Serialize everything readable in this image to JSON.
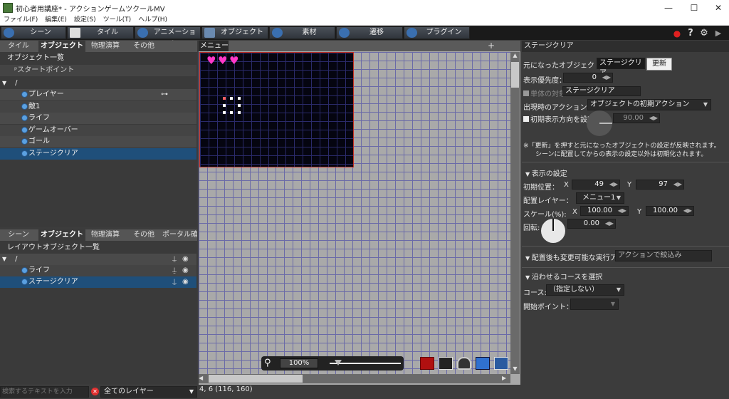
{
  "window": {
    "title": "初心者用講座* - アクションゲームツクールMV",
    "min": "—",
    "max": "☐",
    "close": "✕"
  },
  "menu": [
    "ファイル(F)",
    "編集(E)",
    "設定(S)",
    "ツール(T)",
    "ヘルプ(H)"
  ],
  "toolbar": {
    "tabs": [
      "シーン",
      "タイル",
      "アニメーション",
      "オブジェクト",
      "素材",
      "遷移",
      "プラグイン"
    ],
    "icons": {
      "stop": "●",
      "help": "?",
      "settings": "⚙",
      "play": "▶"
    },
    "colors": {
      "stop": "#e02020"
    }
  },
  "left_top": {
    "tabs": [
      "タイル",
      "オブジェクト",
      "物理演算",
      "その他"
    ],
    "header": "オブジェクト一覧",
    "start_point": "スタートポイント",
    "folder": "/",
    "items": [
      "プレイヤー",
      "敵1",
      "ライフ",
      "ゲームオーバー",
      "ゴール",
      "ステージクリア"
    ],
    "selected_index": 5,
    "gamepad_icon": "gamepad-icon"
  },
  "left_bottom": {
    "tabs": [
      "シーン",
      "オブジェクト",
      "物理演算",
      "その他",
      "ポータル確"
    ],
    "header": "レイアウトオブジェクト一覧",
    "folder": "/",
    "items": [
      "ライフ",
      "ステージクリア"
    ],
    "selected_index": 1
  },
  "canvas": {
    "tab": "メニュー1",
    "zoom": "100%",
    "zoom_slider": 0.12,
    "scrollbar_v": "▲",
    "scrollbar_down": "▼",
    "scroll_left": "◀",
    "scroll_right": "▶",
    "plus": "+"
  },
  "status": {
    "coords": "4, 6 (116, 160)",
    "search_placeholder": "検索するテキストを入力",
    "layer": "全てのレイヤー"
  },
  "right": {
    "title": "ステージクリア",
    "source_label": "元になったオブジェクト:",
    "source_value": "ステージクリア",
    "update": "更新",
    "priority_label": "表示優先度：",
    "priority_value": "0",
    "single_label": "単体の対象",
    "single_value": "ステージクリア",
    "appear_action_label": "出現時のアクション:",
    "appear_action_value": "オブジェクトの初期アクション",
    "initial_dir_label": "初期表示方向を設定",
    "initial_dir_value": "90.00",
    "note1": "※「更新」を押すと元になったオブジェクトの設定が反映されます。",
    "note2": "シーンに配置してからの表示の設定以外は初期化されます。",
    "display_header": "表示の設定",
    "pos_label": "初期位置：",
    "x_label": "X",
    "y_label": "Y",
    "pos_x": "49",
    "pos_y": "97",
    "layer_label": "配置レイヤー：",
    "layer_value": "メニュー1",
    "scale_label": "スケール(%):",
    "scale_x": "100.00",
    "scale_y": "100.00",
    "rot_label": "回転:",
    "rot_value": "0.00",
    "exec_header": "配置後も変更可能な実行ア",
    "exec_filter": "アクションで絞込み",
    "course_header": "沿わせるコースを選択",
    "course_label": "コース:",
    "course_value": "（指定しない）",
    "start_point_label": "開始ポイント：",
    "start_point_value": ""
  }
}
